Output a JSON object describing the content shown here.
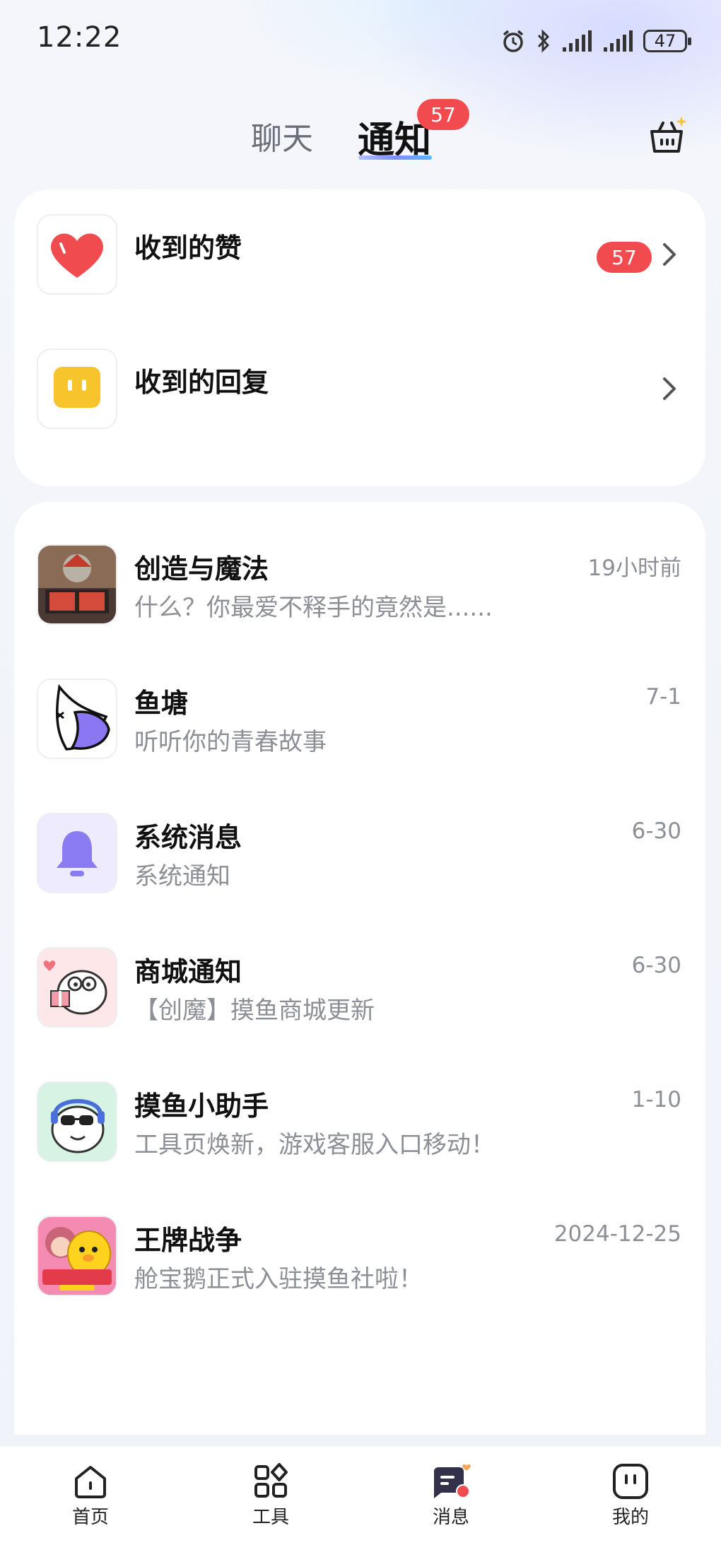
{
  "status_bar": {
    "time": "12:22",
    "battery": "47"
  },
  "tabs": {
    "chat_label": "聊天",
    "notify_label": "通知",
    "notify_badge": "57"
  },
  "interactions": [
    {
      "title": "收到的赞",
      "badge": "57",
      "icon": "heart-icon"
    },
    {
      "title": "收到的回复",
      "badge": "",
      "icon": "reply-face-icon"
    }
  ],
  "messages": [
    {
      "name": "创造与魔法",
      "time": "19小时前",
      "preview": "什么？你最爱不释手的竟然是......",
      "icon": "game-creation-magic-avatar"
    },
    {
      "name": "鱼塘",
      "time": "7-1",
      "preview": "听听你的青春故事",
      "icon": "fish-pond-avatar"
    },
    {
      "name": "系统消息",
      "time": "6-30",
      "preview": "系统通知",
      "icon": "bell-icon"
    },
    {
      "name": "商城通知",
      "time": "6-30",
      "preview": "【创魔】摸鱼商城更新",
      "icon": "shop-mascot-avatar"
    },
    {
      "name": "摸鱼小助手",
      "time": "1-10",
      "preview": "工具页焕新，游戏客服入口移动！",
      "icon": "assistant-mascot-avatar"
    },
    {
      "name": "王牌战争",
      "time": "2024-12-25",
      "preview": "舱宝鹅正式入驻摸鱼社啦！",
      "icon": "game-ace-war-avatar"
    }
  ],
  "nav": {
    "home": "首页",
    "tools": "工具",
    "messages": "消息",
    "mine": "我的"
  },
  "colors": {
    "badge": "#f24b4f",
    "accent": "#7f8dff",
    "bell": "#8a7bf2"
  }
}
